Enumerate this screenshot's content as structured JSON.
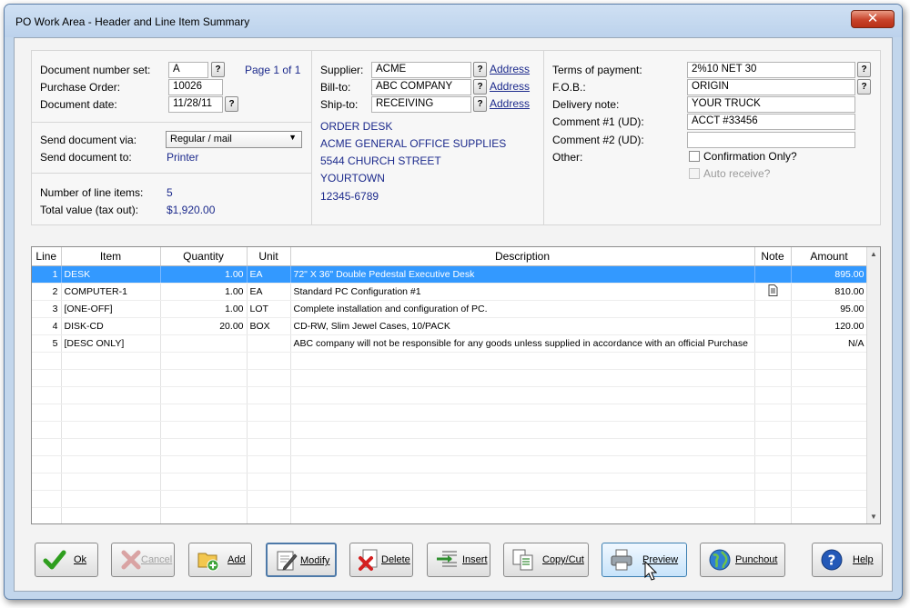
{
  "window": {
    "title": "PO Work Area - Header and Line Item Summary",
    "close": "✕"
  },
  "document": {
    "number_set_label": "Document number set:",
    "number_set": "A",
    "page": "Page 1 of 1",
    "po_label": "Purchase Order:",
    "po": "10026",
    "date_label": "Document date:",
    "date": "11/28/11",
    "send_via_label": "Send document via:",
    "send_via": "Regular / mail",
    "send_to_label": "Send document to:",
    "send_to": "Printer",
    "line_items_label": "Number of line items:",
    "line_items": "5",
    "total_label": "Total value (tax out):",
    "total": "$1,920.00"
  },
  "parties": {
    "supplier_label": "Supplier:",
    "supplier": "ACME",
    "billto_label": "Bill-to:",
    "billto": "ABC COMPANY",
    "shipto_label": "Ship-to:",
    "shipto": "RECEIVING",
    "address_link": "Address",
    "address_lines": [
      "ORDER DESK",
      "ACME GENERAL OFFICE SUPPLIES",
      "5544 CHURCH STREET",
      "YOURTOWN",
      "12345-6789"
    ]
  },
  "terms": {
    "payment_label": "Terms of payment:",
    "payment": "2%10 NET 30",
    "fob_label": "F.O.B.:",
    "fob": "ORIGIN",
    "delivery_label": "Delivery note:",
    "delivery": "YOUR TRUCK",
    "comment1_label": "Comment #1 (UD):",
    "comment1": "ACCT #33456",
    "comment2_label": "Comment #2 (UD):",
    "comment2": "",
    "other_label": "Other:",
    "confirmation": "Confirmation Only?",
    "auto_receive": "Auto receive?"
  },
  "grid": {
    "columns": [
      "Line",
      "Item",
      "Quantity",
      "Unit",
      "Description",
      "Note",
      "Amount"
    ],
    "rows": [
      [
        "1",
        "DESK",
        "1.00",
        "EA",
        "72\" X 36\" Double Pedestal Executive Desk",
        "",
        "895.00"
      ],
      [
        "2",
        "COMPUTER-1",
        "1.00",
        "EA",
        "Standard PC Configuration  #1",
        "note",
        "810.00"
      ],
      [
        "3",
        "[ONE-OFF]",
        "1.00",
        "LOT",
        "Complete installation and configuration of PC.",
        "",
        "95.00"
      ],
      [
        "4",
        "DISK-CD",
        "20.00",
        "BOX",
        "CD-RW, Slim Jewel Cases, 10/PACK",
        "",
        "120.00"
      ],
      [
        "5",
        "[DESC ONLY]",
        "",
        "",
        "ABC company will not be responsible for any goods unless supplied in accordance with an official Purchase",
        "",
        "N/A"
      ]
    ]
  },
  "buttons": {
    "ok": "Ok",
    "cancel": "Cancel",
    "add": "Add",
    "modify": "Modify",
    "delete": "Delete",
    "insert": "Insert",
    "copy_cut": "Copy/Cut",
    "preview": "Preview",
    "punchout": "Punchout",
    "help": "Help"
  },
  "icons": {
    "question": "?",
    "dropdown": "▼",
    "scroll_up": "▲",
    "scroll_down": "▼"
  },
  "colors": {
    "selection": "#3399ff",
    "link": "#1c2a8c",
    "window_frame": "#c2d6ec"
  }
}
